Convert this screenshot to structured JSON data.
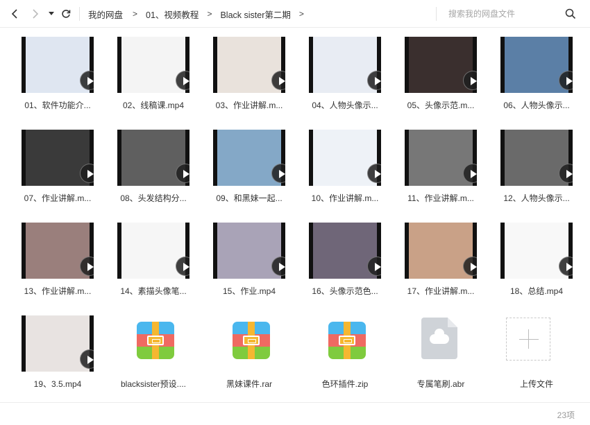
{
  "breadcrumb": [
    "我的网盘",
    "01、视频教程",
    "Black sister第二期"
  ],
  "breadcrumb_sep": ">",
  "search": {
    "placeholder": "搜索我的网盘文件"
  },
  "items": [
    {
      "label": "01、软件功能介...",
      "type": "video",
      "bg": "#dfe6f1"
    },
    {
      "label": "02、线稿课.mp4",
      "type": "video",
      "bg": "#f4f4f4"
    },
    {
      "label": "03、作业讲解.m...",
      "type": "video",
      "bg": "#e9e2dc"
    },
    {
      "label": "04、人物头像示...",
      "type": "video",
      "bg": "#e8ecf3"
    },
    {
      "label": "05、头像示范.m...",
      "type": "video",
      "bg": "#3a2f2e"
    },
    {
      "label": "06、人物头像示...",
      "type": "video",
      "bg": "#5b7fa6"
    },
    {
      "label": "07、作业讲解.m...",
      "type": "video",
      "bg": "#3a3a3a"
    },
    {
      "label": "08、头发结构分...",
      "type": "video",
      "bg": "#5f5f5f"
    },
    {
      "label": "09、和黑妹一起...",
      "type": "video",
      "bg": "#84a8c7"
    },
    {
      "label": "10、作业讲解.m...",
      "type": "video",
      "bg": "#eef2f7"
    },
    {
      "label": "11、作业讲解.m...",
      "type": "video",
      "bg": "#777777"
    },
    {
      "label": "12、人物头像示...",
      "type": "video",
      "bg": "#6a6a6a"
    },
    {
      "label": "13、作业讲解.m...",
      "type": "video",
      "bg": "#9a7f7c"
    },
    {
      "label": "14、素描头像笔...",
      "type": "video",
      "bg": "#f6f6f6"
    },
    {
      "label": "15、作业.mp4",
      "type": "video",
      "bg": "#a9a3b7"
    },
    {
      "label": "16、头像示范色...",
      "type": "video",
      "bg": "#6f6678"
    },
    {
      "label": "17、作业讲解.m...",
      "type": "video",
      "bg": "#c9a187"
    },
    {
      "label": "18、总结.mp4",
      "type": "video",
      "bg": "#f8f8f8"
    },
    {
      "label": "19、3.5.mp4",
      "type": "video",
      "bg": "#e8e3e1"
    },
    {
      "label": "blacksister预设....",
      "type": "archive"
    },
    {
      "label": "黑妹课件.rar",
      "type": "archive"
    },
    {
      "label": "色环插件.zip",
      "type": "archive"
    },
    {
      "label": "专属笔刷.abr",
      "type": "doc"
    },
    {
      "label": "上传文件",
      "type": "upload"
    }
  ],
  "footer": {
    "count": "23项"
  }
}
